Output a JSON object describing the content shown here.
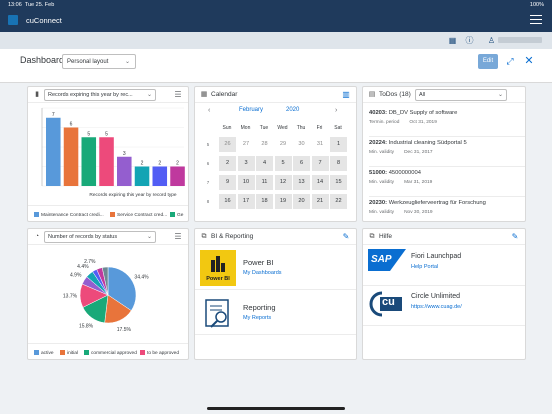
{
  "status": {
    "time": "13:06",
    "date": "Tue 25. Feb",
    "battery": "100%"
  },
  "shell": {
    "title": "cuConnect",
    "user_name_icon": "person-icon"
  },
  "header": {
    "title": "Dashboard",
    "layout_select": "Personal layout",
    "edit_label": "Edit"
  },
  "records_card": {
    "select_label": "Records expiring this year by rec...",
    "legend": [
      "Maintenance Contract credi...",
      "Service Contract cred...",
      "Ge"
    ]
  },
  "calendar_card": {
    "title": "Calendar",
    "month": "February",
    "year": "2020",
    "dow": [
      "Sun",
      "Mon",
      "Tue",
      "Wed",
      "Thu",
      "Fri",
      "Sat"
    ],
    "weeks": [
      "5",
      "6",
      "7",
      "8",
      "9"
    ],
    "days": [
      [
        "26",
        "27",
        "28",
        "29",
        "30",
        "31",
        "1"
      ],
      [
        "2",
        "3",
        "4",
        "5",
        "6",
        "7",
        "8"
      ],
      [
        "9",
        "10",
        "11",
        "12",
        "13",
        "14",
        "15"
      ],
      [
        "16",
        "17",
        "18",
        "19",
        "20",
        "21",
        "22"
      ]
    ]
  },
  "todos_card": {
    "title": "ToDos (18)",
    "filter": "All",
    "items": [
      {
        "id": "40203:",
        "text": "DB_DV Supply of software",
        "label": "Termin. period",
        "date": "Oct 31, 2019"
      },
      {
        "id": "20224:",
        "text": "Industrial cleaning Südportal 5",
        "label": "Min. validity",
        "date": "Dec 31, 2017"
      },
      {
        "id": "51000:",
        "text": "4500000004",
        "label": "Min. validity",
        "date": "Mar 31, 2019"
      },
      {
        "id": "20230:",
        "text": "Werkzeuglieferveertrag für Forschung",
        "label": "Min. validity",
        "date": "Nov 30, 2019"
      }
    ]
  },
  "status_card": {
    "select_label": "Number of records by status",
    "legend": [
      "active",
      "initial",
      "commercial approved",
      "to be approved"
    ]
  },
  "bi_card": {
    "title": "BI & Reporting",
    "items": [
      {
        "name": "Power BI",
        "sub": "My Dashboards",
        "tile_text": "Power BI"
      },
      {
        "name": "Reporting",
        "sub": "My Reports"
      }
    ]
  },
  "hilfe_card": {
    "title": "Hilfe",
    "items": [
      {
        "name": "Fiori Launchpad",
        "sub": "Help Portal",
        "logo_text": "SAP"
      },
      {
        "name": "Circle Unlimited",
        "sub": "https://www.cuag.de/",
        "logo_text": "cu"
      }
    ]
  },
  "chart_data": [
    {
      "type": "bar",
      "title": "",
      "xlabel": "Records expiring this year by record type",
      "ylabel": "",
      "categories": [
        "1",
        "2",
        "3",
        "4",
        "5",
        "6",
        "7",
        "8"
      ],
      "values": [
        7,
        6,
        5,
        5,
        3,
        2,
        2,
        2
      ],
      "colors": [
        "#5899da",
        "#e8743b",
        "#19a979",
        "#ed4a7b",
        "#945ecf",
        "#13a4b4",
        "#525df4",
        "#bf399e"
      ],
      "ylim": [
        0,
        8
      ],
      "grid": true
    },
    {
      "type": "pie",
      "title": "",
      "labels": [
        "34.4%",
        "17.5%",
        "15.8%",
        "13.7%",
        "4.9%",
        "4.4%",
        "2.7%"
      ],
      "values": [
        34.4,
        17.5,
        15.8,
        13.7,
        4.9,
        4.4,
        2.7,
        3.3,
        3.3
      ],
      "colors": [
        "#5899da",
        "#e8743b",
        "#19a979",
        "#ed4a7b",
        "#945ecf",
        "#13a4b4",
        "#525df4",
        "#bf399e",
        "#6c8893"
      ],
      "legend": "bottom"
    }
  ]
}
